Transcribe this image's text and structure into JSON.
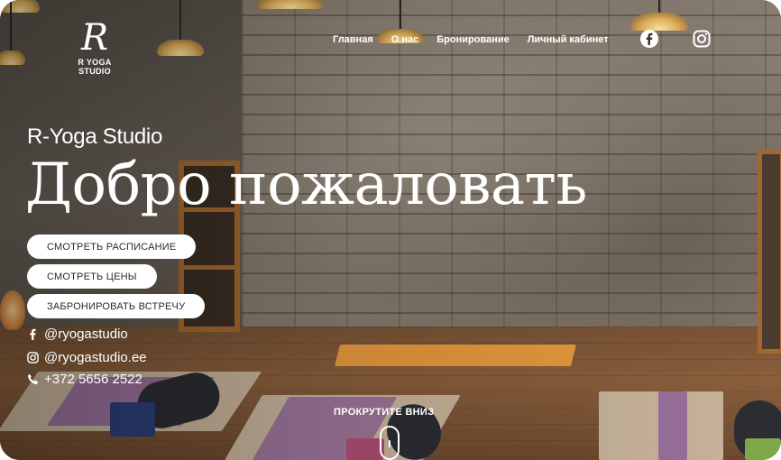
{
  "brand": {
    "logo_mark": "R",
    "logo_text": "R YOGA STUDIO"
  },
  "nav": {
    "items": [
      "Главная",
      "О нас",
      "Бронирование",
      "Личный кабинет"
    ]
  },
  "social_icons": [
    "facebook-icon",
    "instagram-icon"
  ],
  "hero": {
    "subtitle": "R-Yoga Studio",
    "headline": "Добро пожаловать",
    "buttons": [
      "СМОТРЕТЬ РАСПИСАНИЕ",
      "СМОТРЕТЬ ЦЕНЫ",
      "ЗАБРОНИРОВАТЬ ВСТРЕЧУ"
    ]
  },
  "contacts": {
    "facebook": "@ryogastudio",
    "instagram": "@ryogastudio.ee",
    "phone": "+372 5656 2522"
  },
  "scroll": {
    "label": "ПРОКРУТИТЕ ВНИЗ"
  },
  "colors": {
    "text": "#ffffff",
    "button_bg": "#ffffff",
    "button_text": "#2b2b2b",
    "mat_orange": "#e79a3e",
    "mat_purple": "#8a5a9a",
    "wood": "#a4682e"
  }
}
